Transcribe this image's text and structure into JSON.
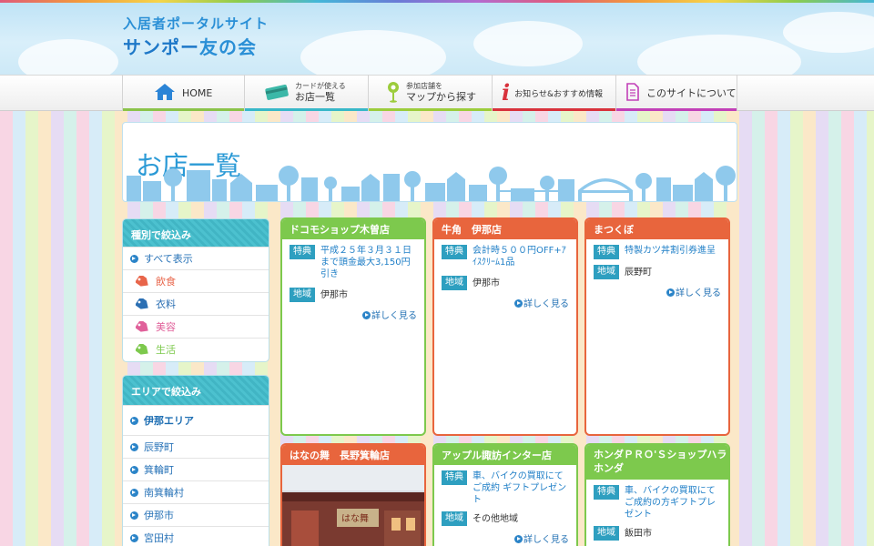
{
  "colors": {
    "green": "#7dc94d",
    "orange": "#e8653d",
    "teal": "#41b5c4",
    "blue": "#2b9ad6"
  },
  "logo": {
    "sub": "入居者ポータルサイト",
    "main_a": "サンポー",
    "main_b": "友の会"
  },
  "nav": {
    "home": "HOME",
    "card_small": "カードが使える",
    "card_big": "お店一覧",
    "map_small": "参加店舗を",
    "map_big": "マップから探す",
    "info": "お知らせ&おすすめ情報",
    "about": "このサイトについて"
  },
  "page_title": "お店一覧",
  "sidebar": {
    "cat_title": "種別で絞込み",
    "cat_items": [
      {
        "label": "すべて表示"
      },
      {
        "label": "飲食",
        "color": "#e8654a",
        "icon": "tag-icon"
      },
      {
        "label": "衣料",
        "color": "#2b6fb3",
        "icon": "tag-icon"
      },
      {
        "label": "美容",
        "color": "#e0609a",
        "icon": "tag-icon"
      },
      {
        "label": "生活",
        "color": "#7dc94d",
        "icon": "tag-icon"
      }
    ],
    "area_title": "エリアで絞込み",
    "area_group": "伊那エリア",
    "area_items": [
      "辰野町",
      "箕輪町",
      "南箕輪村",
      "伊那市",
      "宮田村"
    ]
  },
  "labels": {
    "tokuten": "特典",
    "chiiki": "地域",
    "more": "詳しく見る"
  },
  "cards": [
    {
      "name": "ドコモショップ木曽店",
      "benefit": "平成２５年３月３１日まで頭金最大3,150円引き",
      "area": "伊那市"
    },
    {
      "name": "牛角　伊那店",
      "benefit": "会計時５００円OFF+ｱｲｽｸﾘｰﾑ1品",
      "area": "伊那市"
    },
    {
      "name": "まつくぼ",
      "benefit": "特製カツ丼割引券進呈",
      "area": "辰野町"
    },
    {
      "name": "はなの舞　長野箕輪店"
    },
    {
      "name": "アップル諏訪インター店",
      "benefit": "車、バイクの買取にてご成約 ギフトプレゼント",
      "area": "その他地域"
    },
    {
      "name": "ホンダＰＲＯ'Ｓショップハラホンダ",
      "benefit": "車、バイクの買取にてご成約の方ギフトプレゼント",
      "area": "飯田市"
    }
  ],
  "photo_sign": "はな舞"
}
